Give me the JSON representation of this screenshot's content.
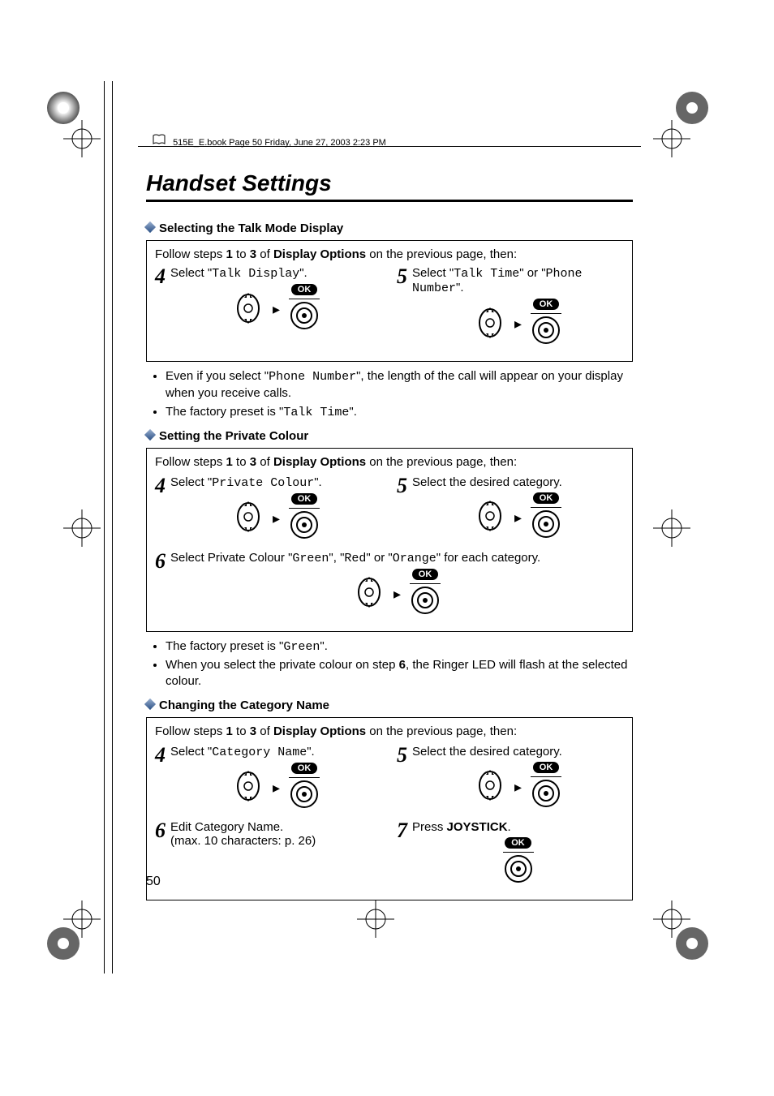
{
  "header": {
    "info": "515E_E.book  Page 50  Friday, June 27, 2003  2:23 PM"
  },
  "title": "Handset Settings",
  "ok_label": "OK",
  "sections": [
    {
      "heading": "Selecting the Talk Mode Display",
      "intro_prefix": "Follow steps ",
      "intro_bold1": "1",
      "intro_mid": " to ",
      "intro_bold2": "3",
      "intro_mid2": " of ",
      "intro_bold3": "Display Options",
      "intro_suffix": " on the previous page, then:",
      "steps": [
        {
          "n": "4",
          "pre": "Select \"",
          "mono": "Talk Display",
          "post": "\".",
          "icons": "nav-ok"
        },
        {
          "n": "5",
          "pre": "Select \"",
          "mono": "Talk Time",
          "mid": "\" or \"",
          "mono2": "Phone Number",
          "post": "\".",
          "icons": "nav-ok"
        }
      ],
      "bullets": [
        {
          "pre": "Even if you select \"",
          "mono": "Phone Number",
          "post": "\", the length of the call will appear on your display when you receive calls."
        },
        {
          "pre": "The factory preset is \"",
          "mono": "Talk Time",
          "post": "\"."
        }
      ]
    },
    {
      "heading": "Setting the Private Colour",
      "intro_prefix": "Follow steps ",
      "intro_bold1": "1",
      "intro_mid": " to ",
      "intro_bold2": "3",
      "intro_mid2": " of ",
      "intro_bold3": "Display Options",
      "intro_suffix": " on the previous page, then:",
      "steps_rows": [
        [
          {
            "n": "4",
            "pre": "Select \"",
            "mono": "Private Colour",
            "post": "\".",
            "icons": "nav-ok"
          },
          {
            "n": "5",
            "text": "Select the desired category.",
            "icons": "nav-ok"
          }
        ],
        [
          {
            "n": "6",
            "pre": "Select Private Colour \"",
            "mono": "Green",
            "mid": "\", \"",
            "mono2": "Red",
            "mid2": "\" or \"",
            "mono3": "Orange",
            "post": "\" for each category.",
            "icons": "nav-ok",
            "full": true
          }
        ]
      ],
      "bullets": [
        {
          "pre": "The factory preset is \"",
          "mono": "Green",
          "post": "\"."
        },
        {
          "pre": "When you select the private colour on step ",
          "bold": "6",
          "post": ", the Ringer LED will flash at the selected colour."
        }
      ]
    },
    {
      "heading": "Changing the Category Name",
      "intro_prefix": "Follow steps ",
      "intro_bold1": "1",
      "intro_mid": " to ",
      "intro_bold2": "3",
      "intro_mid2": " of ",
      "intro_bold3": "Display Options",
      "intro_suffix": " on the previous page, then:",
      "steps_rows": [
        [
          {
            "n": "4",
            "pre": "Select \"",
            "mono": "Category Name",
            "post": "\".",
            "icons": "nav-ok"
          },
          {
            "n": "5",
            "text": "Select the desired category.",
            "icons": "nav-ok"
          }
        ],
        [
          {
            "n": "6",
            "text": "Edit Category Name.",
            "sub": "(max. 10 characters: p. 26)"
          },
          {
            "n": "7",
            "pre": "Press ",
            "bold": "JOYSTICK",
            "post": ".",
            "icons": "ok-only"
          }
        ]
      ]
    }
  ],
  "page_number": "50"
}
